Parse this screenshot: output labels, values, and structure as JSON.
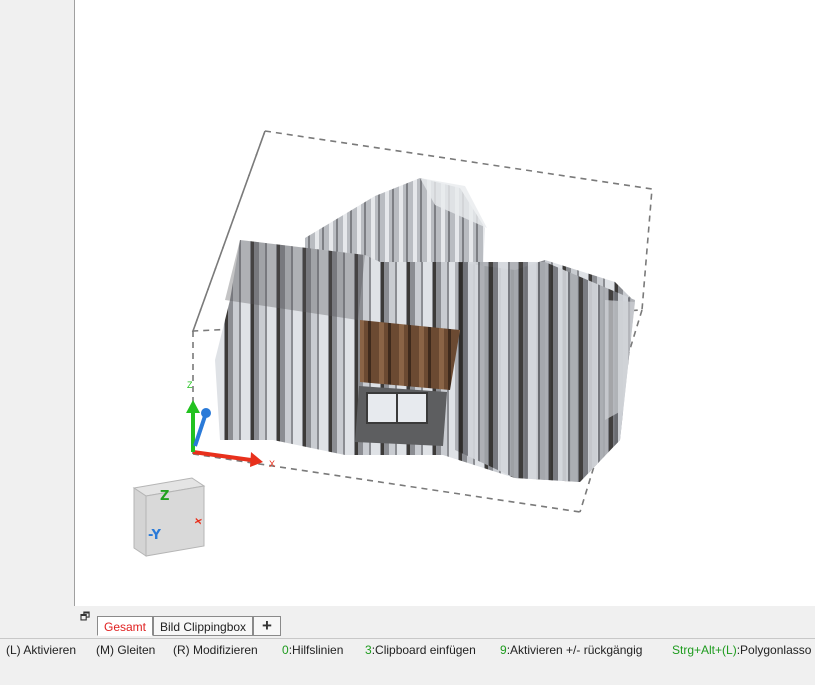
{
  "viewport": {
    "axes": {
      "x_label": "X",
      "z_label": "Z"
    },
    "view_cube": {
      "top_label": "Z",
      "front_label": "-Y",
      "right_label": "X"
    },
    "colors": {
      "x_axis": "#e8301c",
      "y_axis": "#2a7ad8",
      "z_axis": "#22c21f",
      "bbox": "#7a7a7a"
    }
  },
  "tabs": {
    "restore_icon": "restore-window-icon",
    "items": [
      {
        "label": "Gesamt",
        "active": true
      },
      {
        "label": "Bild Clippingbox",
        "active": false
      }
    ],
    "add_label": "+"
  },
  "status": {
    "hints": [
      {
        "key": "(L)",
        "text": " Aktivieren"
      },
      {
        "key": "(M)",
        "text": " Gleiten"
      },
      {
        "key": "(R)",
        "text": " Modifizieren"
      },
      {
        "key": "0",
        "text": ":Hilfslinien"
      },
      {
        "key": "3",
        "text": ":Clipboard einfügen"
      },
      {
        "key": "9",
        "text": ":Aktivieren +/- rückgängig"
      },
      {
        "key": "Strg+Alt+(L)",
        "text": ":Polygonlasso"
      }
    ]
  }
}
